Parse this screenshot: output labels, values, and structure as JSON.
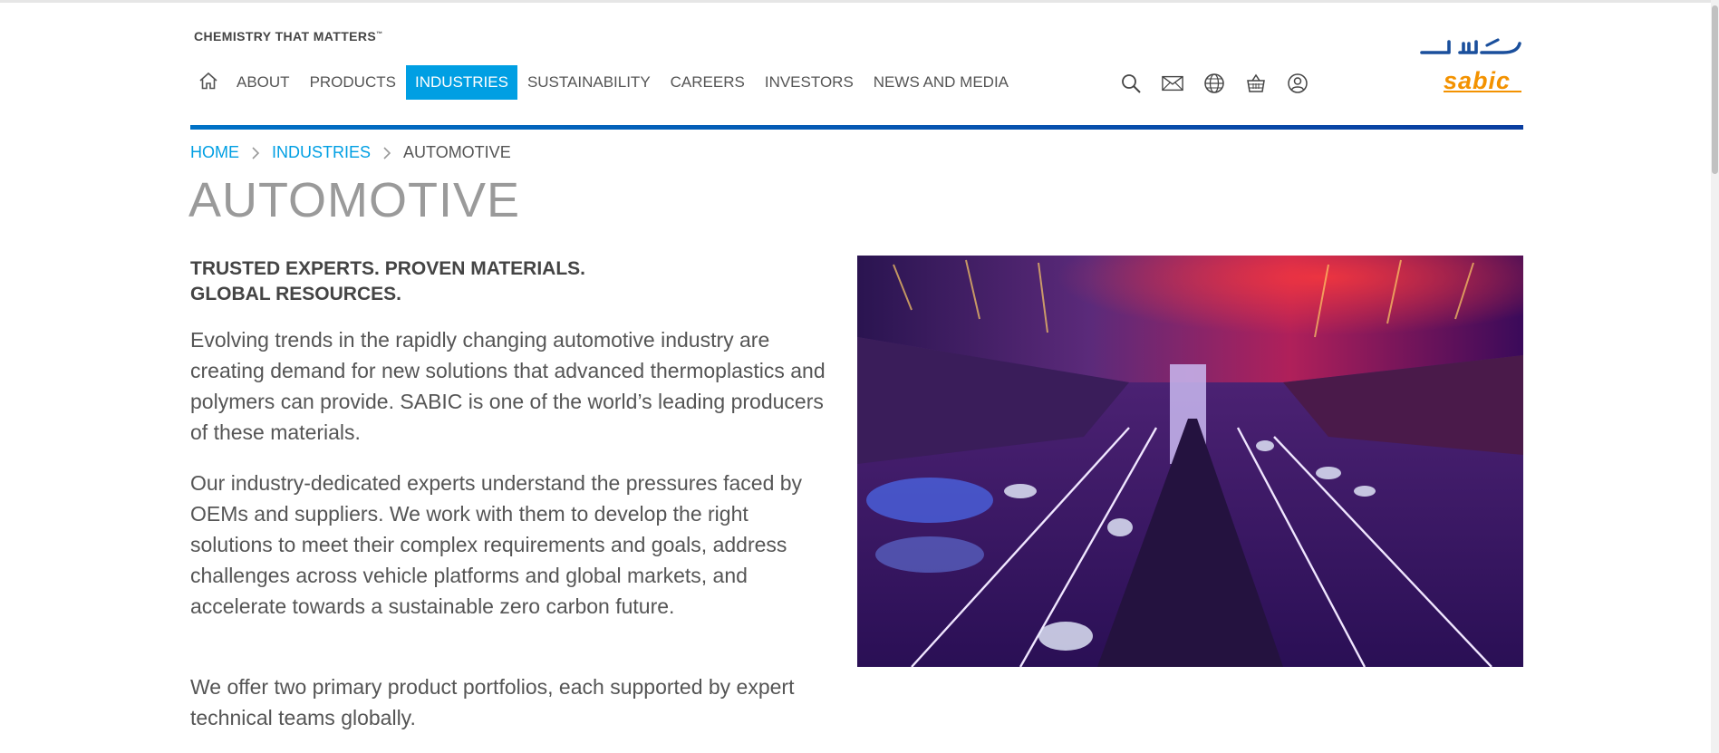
{
  "header": {
    "tagline": "CHEMISTRY THAT MATTERS",
    "tagline_mark": "™",
    "logo": {
      "arabic": "سابك",
      "latin": "sabic",
      "arabic_color": "#1a4f9c",
      "latin_color": "#f39200"
    },
    "nav": {
      "home_icon": "home-icon",
      "items": [
        {
          "label": "ABOUT",
          "active": false
        },
        {
          "label": "PRODUCTS",
          "active": false
        },
        {
          "label": "INDUSTRIES",
          "active": true
        },
        {
          "label": "SUSTAINABILITY",
          "active": false
        },
        {
          "label": "CAREERS",
          "active": false
        },
        {
          "label": "INVESTORS",
          "active": false
        },
        {
          "label": "NEWS AND MEDIA",
          "active": false
        }
      ]
    },
    "utility_icons": [
      "search-icon",
      "mail-icon",
      "globe-icon",
      "basket-icon",
      "user-icon"
    ],
    "accent_color": "#009fe3",
    "rule_color": "#0a4fb0"
  },
  "breadcrumb": {
    "items": [
      "HOME",
      "INDUSTRIES"
    ],
    "current": "AUTOMOTIVE"
  },
  "page": {
    "title": "AUTOMOTIVE",
    "subheading_line1": "TRUSTED EXPERTS. PROVEN MATERIALS.",
    "subheading_line2": "GLOBAL RESOURCES.",
    "paragraphs": [
      "Evolving trends in the rapidly changing automotive industry are creating demand for new solutions that advanced thermoplastics and polymers can provide. SABIC is one of the world’s leading producers of these materials.",
      "Our industry-dedicated experts understand the pressures faced by OEMs and suppliers. We work with them to develop the right solutions to meet their complex requirements and goals, address challenges across vehicle platforms and global markets, and accelerate towards a sustainable zero carbon future.",
      "We offer two primary product portfolios, each supported by expert technical teams globally."
    ]
  },
  "hero_image": {
    "subject": "night-highway-traffic-photo"
  }
}
